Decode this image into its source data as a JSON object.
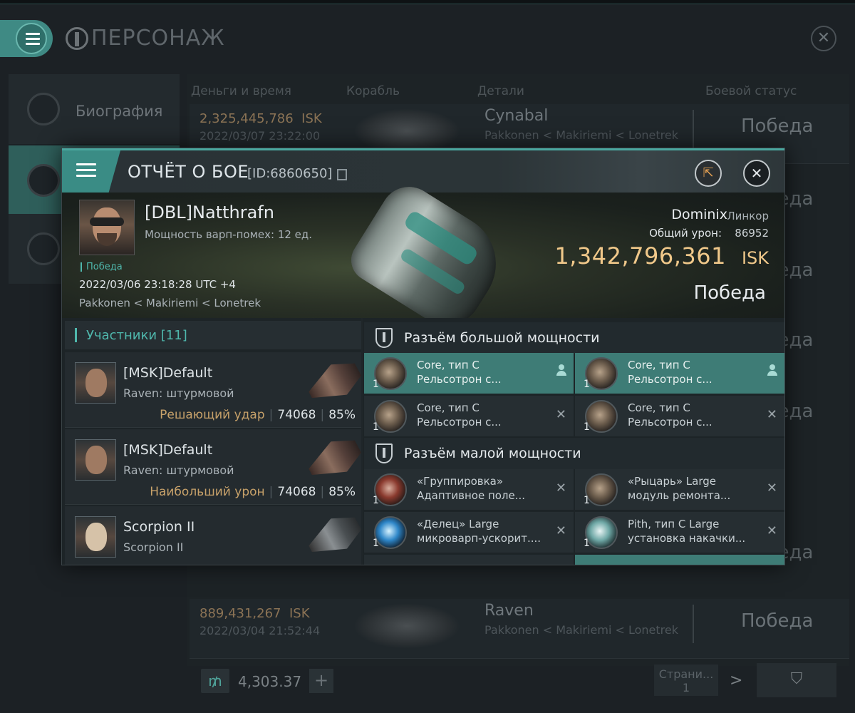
{
  "background_window": {
    "title": "ПЕРСОНАЖ",
    "sidebar": [
      {
        "label": "Биография",
        "icon": "list-icon"
      },
      {
        "label": "",
        "icon": "crossed-swords-icon"
      },
      {
        "label": "",
        "icon": "star-badge-icon"
      }
    ],
    "columns": [
      "Деньги и время",
      "Корабль",
      "Детали",
      "Боевой статус"
    ],
    "rows": [
      {
        "isk": "2,325,445,786",
        "isk_unit": "ISK",
        "date": "2022/03/07  23:22:00",
        "ship": "Cynabal",
        "location": "Pakkonen < Makiriemi < Lonetrek",
        "status": "Победа"
      },
      {
        "isk": "889,431,267",
        "isk_unit": "ISK",
        "date": "2022/03/04  21:52:44",
        "ship": "Raven",
        "location": "Pakkonen < Makiriemi < Lonetrek",
        "status": "Победа"
      }
    ],
    "partial_statuses": [
      "Победа",
      "Победа",
      "Победа",
      "Победа",
      "Победа"
    ],
    "wallet_value": "4,303.37",
    "page_label": "Страни...",
    "page_number": "1"
  },
  "modal": {
    "title": "ОТЧЁТ О БОЕ",
    "report_id": "[ID:6860650]",
    "pilot": {
      "name": "[DBL]Natthrafn",
      "subtitle": "Мощность варп-помех: 12 ед.",
      "status": "Победа",
      "datetime": "2022/03/06 23:18:28 UTC +4",
      "location": "Pakkonen < Makiriemi < Lonetrek"
    },
    "victim_ship": {
      "name": "Dominix",
      "class": "Линкор",
      "damage_label": "Общий урон:",
      "damage_value": "86952",
      "isk_value": "1,342,796,361",
      "isk_unit": "ISK",
      "result": "Победа"
    },
    "participants": {
      "label": "Участники [11]",
      "items": [
        {
          "name": "[MSK]Default",
          "ship": "Raven: штурмовой",
          "tag": "Решающий удар",
          "damage": "74068",
          "percent": "85%"
        },
        {
          "name": "[MSK]Default",
          "ship": "Raven: штурмовой",
          "tag": "Наибольший урон",
          "damage": "74068",
          "percent": "85%"
        },
        {
          "name": "Scorpion II",
          "ship": "Scorpion II",
          "tag": "",
          "damage": "",
          "percent": ""
        }
      ]
    },
    "high_slots": {
      "label": "Разъём большой мощности",
      "items": [
        {
          "qty": "1",
          "line1": "Core, тип C",
          "line2": "Рельсотрон с...",
          "state": "pilot",
          "icon": "gun"
        },
        {
          "qty": "1",
          "line1": "Core, тип C",
          "line2": "Рельсотрон с...",
          "state": "pilot",
          "icon": "gun"
        },
        {
          "qty": "1",
          "line1": "Core, тип C",
          "line2": "Рельсотрон с...",
          "state": "destroyed",
          "icon": "gun"
        },
        {
          "qty": "1",
          "line1": "Core, тип C",
          "line2": "Рельсотрон с...",
          "state": "destroyed",
          "icon": "gun"
        }
      ]
    },
    "low_slots": {
      "label": "Разъём малой мощности",
      "items": [
        {
          "qty": "1",
          "line1": "«Группировка»",
          "line2": "Адаптивное поле...",
          "state": "destroyed",
          "icon": "red"
        },
        {
          "qty": "1",
          "line1": "«Рыцарь» Large",
          "line2": "модуль ремонта...",
          "state": "destroyed",
          "icon": "gun"
        },
        {
          "qty": "1",
          "line1": "«Делец» Large",
          "line2": "микроварп-ускорит....",
          "state": "destroyed",
          "icon": "blue"
        },
        {
          "qty": "1",
          "line1": "Pith, тип C Large",
          "line2": "установка накачки...",
          "state": "destroyed",
          "icon": "teal"
        }
      ]
    }
  }
}
